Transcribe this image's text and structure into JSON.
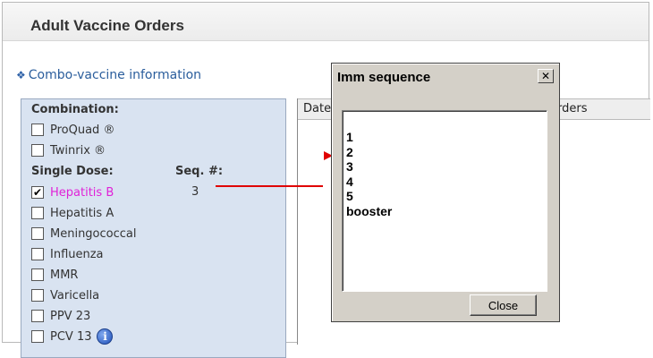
{
  "page": {
    "title": "Adult Vaccine Orders"
  },
  "combo_link": {
    "icon": "diamond-icon",
    "label": "Combo-vaccine information"
  },
  "left_panel": {
    "combination_label": "Combination:",
    "combination_items": [
      {
        "label": "ProQuad ®",
        "checked": false
      },
      {
        "label": "Twinrix ®",
        "checked": false
      }
    ],
    "single_dose_label": "Single Dose:",
    "seq_header": "Seq. #:",
    "single_dose_items": [
      {
        "label": "Hepatitis B",
        "checked": true,
        "seq": "3"
      },
      {
        "label": "Hepatitis A",
        "checked": false
      },
      {
        "label": "Meningococcal",
        "checked": false
      },
      {
        "label": "Influenza",
        "checked": false
      },
      {
        "label": "MMR",
        "checked": false
      },
      {
        "label": "Varicella",
        "checked": false
      },
      {
        "label": "PPV 23",
        "checked": false
      },
      {
        "label": "PCV 13",
        "checked": false,
        "info_icon": "i"
      }
    ]
  },
  "orders_table": {
    "col_date": "Date",
    "col_orders": "rders"
  },
  "dialog": {
    "title": "Imm sequence",
    "close_glyph": "✕",
    "items": [
      "1",
      "2",
      "3",
      "4",
      "5",
      "booster"
    ],
    "close_button": "Close"
  },
  "colors": {
    "selected_vaccine": "#e022d8",
    "annotation": "#e00000",
    "panel_bg": "#d9e3f1"
  }
}
